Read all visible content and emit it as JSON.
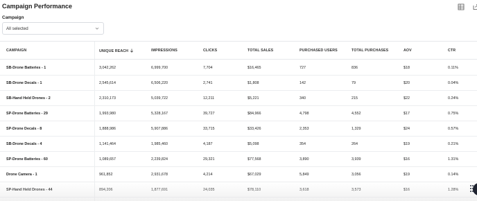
{
  "header": {
    "title": "Campaign Performance",
    "grid_icon": "table-grid-icon",
    "export_icon": "export-icon"
  },
  "filter": {
    "label": "Campaign",
    "selected": "All selected",
    "chevron_icon": "chevron-down-icon"
  },
  "table": {
    "sort_icon": "arrow-down-icon",
    "columns": [
      "CAMPAIGN",
      "UNIQUE REACH",
      "IMPRESSIONS",
      "CLICKS",
      "TOTAL SALES",
      "PURCHASED USERS",
      "TOTAL PURCHASES",
      "AOV",
      "CTR"
    ],
    "rows": [
      [
        "SB-Drone Batteries - 1",
        "3,042,262",
        "6,999,700",
        "7,704",
        "$16,465",
        "727",
        "836",
        "$18",
        "0.11%"
      ],
      [
        "SB-Drone Decals - 1",
        "2,545,614",
        "6,506,220",
        "2,741",
        "$1,808",
        "142",
        "79",
        "$20",
        "0.04%"
      ],
      [
        "SB-Hand Held Drones - 2",
        "2,310,173",
        "5,039,722",
        "12,211",
        "$5,221",
        "340",
        "215",
        "$22",
        "0.24%"
      ],
      [
        "SP-Drone Batteries - 29",
        "1,993,980",
        "5,328,167",
        "39,727",
        "$84,966",
        "4,798",
        "4,552",
        "$17",
        "0.75%"
      ],
      [
        "SP-Drone Decals - 8",
        "1,888,986",
        "5,907,886",
        "33,715",
        "$33,426",
        "2,353",
        "1,329",
        "$24",
        "0.57%"
      ],
      [
        "SB-Drone Decals - 4",
        "1,141,464",
        "1,985,460",
        "4,187",
        "$5,098",
        "354",
        "264",
        "$19",
        "0.21%"
      ],
      [
        "SP-Drone Batteries - 60",
        "1,089,657",
        "2,239,824",
        "29,321",
        "$77,568",
        "3,890",
        "3,939",
        "$16",
        "1.31%"
      ],
      [
        "Drone Camera - 1",
        "961,852",
        "2,931,678",
        "4,214",
        "$67,029",
        "5,849",
        "3,056",
        "$19",
        "0.14%"
      ],
      [
        "SP-Hand Held Drones - 44",
        "894,206",
        "1,877,691",
        "24,035",
        "$78,110",
        "3,618",
        "3,573",
        "$16",
        "1.28%"
      ]
    ]
  },
  "fab_icon": "drag-grip-icon"
}
